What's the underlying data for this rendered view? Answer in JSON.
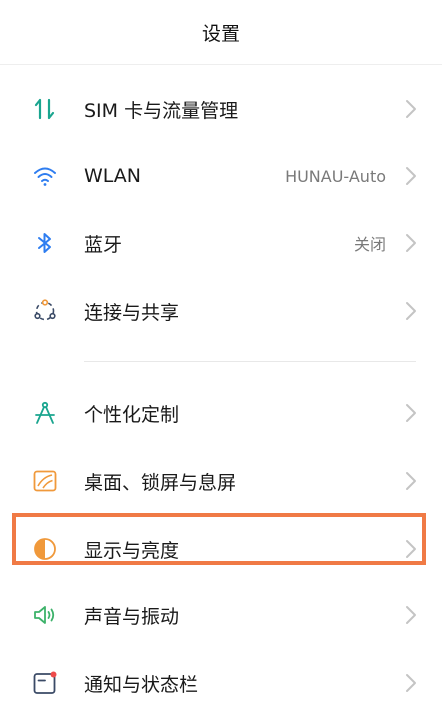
{
  "header": {
    "title": "设置"
  },
  "items": [
    {
      "label": "SIM 卡与流量管理",
      "value": "",
      "icon": "sim-data-icon"
    },
    {
      "label": "WLAN",
      "value": "HUNAU-Auto",
      "icon": "wifi-icon"
    },
    {
      "label": "蓝牙",
      "value": "关闭",
      "icon": "bluetooth-icon"
    },
    {
      "label": "连接与共享",
      "value": "",
      "icon": "connection-share-icon"
    },
    {
      "label": "个性化定制",
      "value": "",
      "icon": "personalization-icon"
    },
    {
      "label": "桌面、锁屏与息屏",
      "value": "",
      "icon": "wallpaper-icon"
    },
    {
      "label": "显示与亮度",
      "value": "",
      "icon": "display-brightness-icon"
    },
    {
      "label": "声音与振动",
      "value": "",
      "icon": "sound-icon"
    },
    {
      "label": "通知与状态栏",
      "value": "",
      "icon": "notification-icon"
    }
  ],
  "colors": {
    "highlight": "#f07a45",
    "icon_teal": "#1aa58f",
    "icon_blue": "#2e7df0",
    "icon_orange": "#f0993b",
    "icon_green": "#3db26a",
    "icon_slate": "#3a4a66"
  }
}
